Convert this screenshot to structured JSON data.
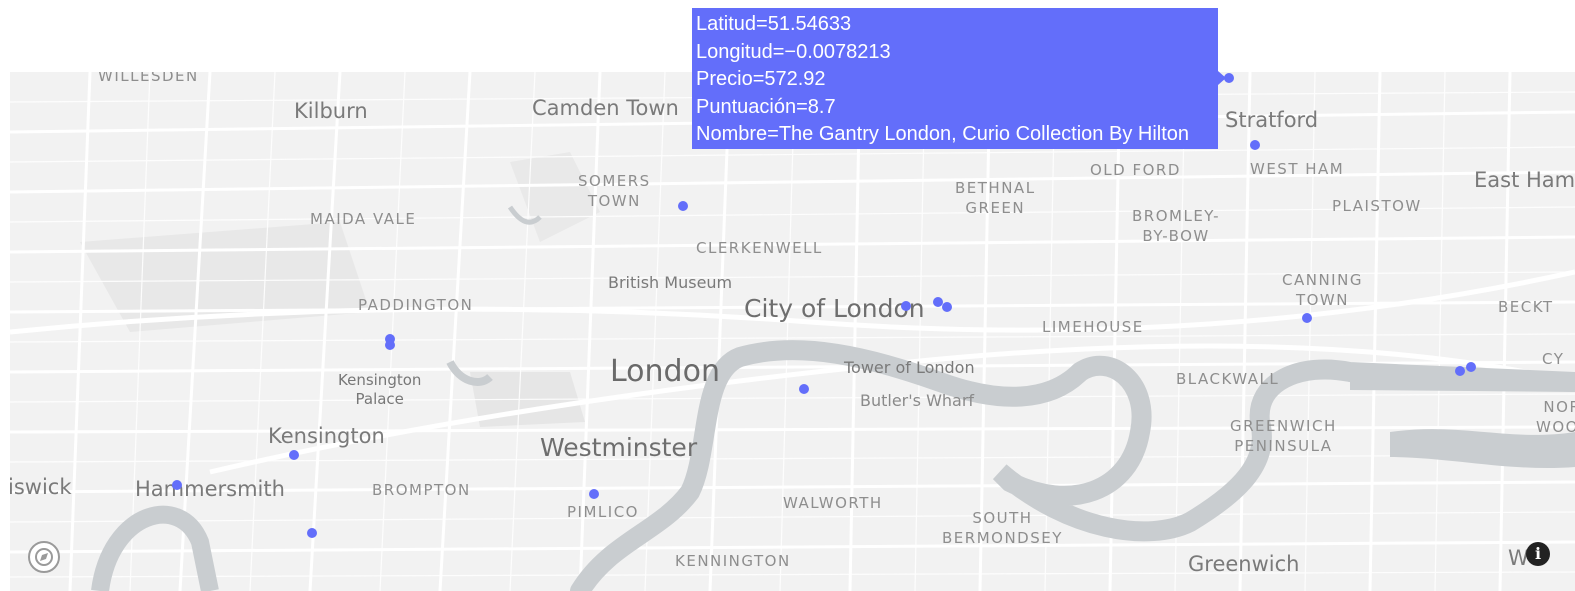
{
  "tooltip": {
    "lines": [
      "Latitud=51.54633",
      "Longitud=−0.0078213",
      "Precio=572.92",
      "Puntuación=8.7",
      "Nombre=The Gantry London, Curio Collection By Hilton"
    ]
  },
  "map_labels": {
    "willesden": "WILLESDEN",
    "kilburn": "Kilburn",
    "camden_town": "Camden Town",
    "somers_town_1": "SOMERS",
    "somers_town_2": "TOWN",
    "maida_vale": "MAIDA VALE",
    "clerkenwell": "CLERKENWELL",
    "british_museum": "British Museum",
    "paddington": "PADDINGTON",
    "city_of_london": "City of London",
    "bethnal_green_1": "BETHNAL",
    "bethnal_green_2": "GREEN",
    "old_ford": "OLD FORD",
    "stratford": "Stratford",
    "west_ham": "WEST HAM",
    "east_ham": "East Ham",
    "plaistow": "PLAISTOW",
    "bromley_by_bow_1": "BROMLEY-",
    "bromley_by_bow_2": "BY-BOW",
    "canning_town_1": "CANNING",
    "canning_town_2": "TOWN",
    "beckton": "BECKT",
    "limehouse": "LIMEHOUSE",
    "london": "London",
    "tower_of_london": "Tower of London",
    "butlers_wharf": "Butler's Wharf",
    "blackwall": "BLACKWALL",
    "greenwich_peninsula_1": "GREENWICH",
    "greenwich_peninsula_2": "PENINSULA",
    "north_woolwich_1": "NOR",
    "north_woolwich_2": "WOOL",
    "cy": "CY",
    "kensington_palace_1": "Kensington",
    "kensington_palace_2": "Palace",
    "kensington": "Kensington",
    "westminster": "Westminster",
    "chiswick": "iswick",
    "hammersmith": "Hammersmith",
    "brompton": "BROMPTON",
    "pimlico": "PIMLICO",
    "walworth": "WALWORTH",
    "south_bermondsey_1": "SOUTH",
    "south_bermondsey_2": "BERMONDSEY",
    "kennington": "KENNINGTON",
    "greenwich": "Greenwich",
    "woolwich_partial": "W"
  },
  "marker_color": "#636efa",
  "info_glyph": "i"
}
